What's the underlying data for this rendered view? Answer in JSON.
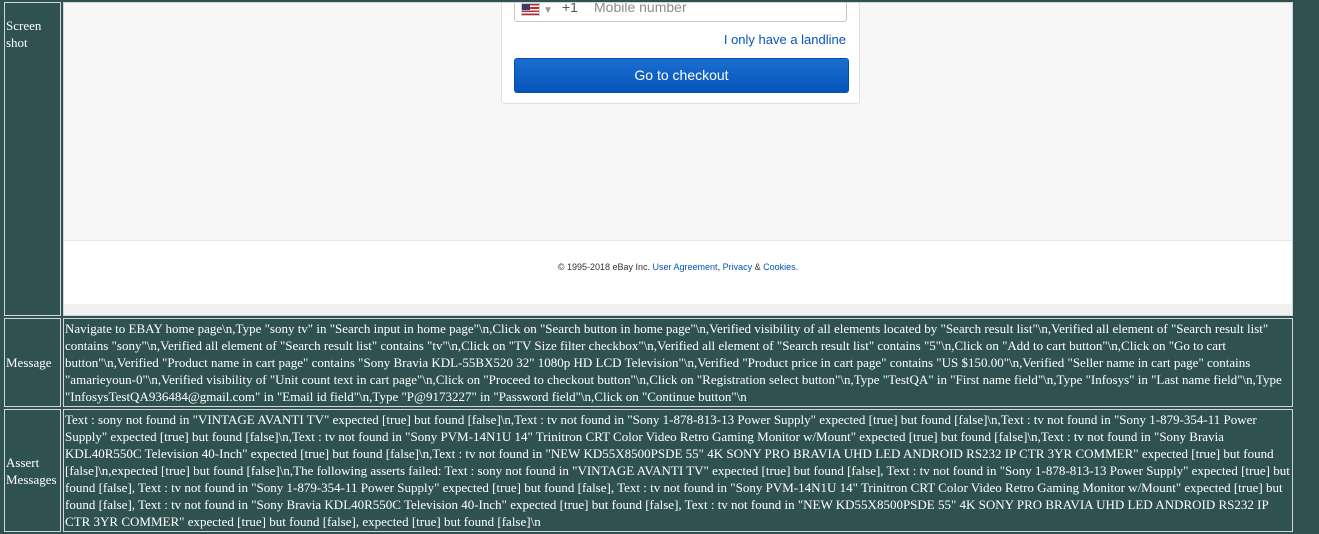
{
  "rows": {
    "screenshot": {
      "label": "Screen shot"
    },
    "message": {
      "label": "Message"
    },
    "assert": {
      "label": "Assert Messages"
    }
  },
  "screenshot_content": {
    "country_code": "+1",
    "mobile_placeholder": "Mobile number",
    "landline_link": "I only have a landline",
    "checkout_button": "Go to checkout",
    "footer": {
      "copyright": "© 1995-2018 eBay Inc.",
      "user_agreement": "User Agreement",
      "sep1": ",",
      "privacy": "Privacy",
      "amp": "&",
      "cookies": "Cookies",
      "period": "."
    }
  },
  "message_text": "Navigate to EBAY home page\\n,Type \"sony tv\" in \"Search input in home page\"\\n,Click on \"Search button in home page\"\\n,Verified visibility of all elements located by \"Search result list\"\\n,Verified all element of \"Search result list\" contains \"sony\"\\n,Verified all element of \"Search result list\" contains \"tv\"\\n,Click on \"TV Size filter checkbox\"\\n,Verified all element of \"Search result list\" contains \"5\"\\n,Click on \"Add to cart button\"\\n,Click on \"Go to cart button\"\\n,Verified \"Product name in cart page\" contains \"Sony Bravia KDL-55BX520 32\" 1080p HD LCD Television\"\\n,Verified \"Product price in cart page\" contains \"US $150.00\"\\n,Verified \"Seller name in cart page\" contains \"amarieyoun-0\"\\n,Verified visibility of \"Unit count text in cart page\"\\n,Click on \"Proceed to checkout button\"\\n,Click on \"Registration select button\"\\n,Type \"TestQA\" in \"First name field\"\\n,Type \"Infosys\" in \"Last name field\"\\n,Type \"InfosysTestQA936484@gmail.com\" in \"Email id field\"\\n,Type \"P@9173227\" in \"Password field\"\\n,Click on \"Continue button\"\\n",
  "assert_text": "Text : sony not found in \"VINTAGE AVANTI TV\" expected [true] but found [false]\\n,Text : tv not found in \"Sony 1-878-813-13 Power Supply\" expected [true] but found [false]\\n,Text : tv not found in \"Sony 1-879-354-11 Power Supply\" expected [true] but found [false]\\n,Text : tv not found in \"Sony PVM-14N1U 14\" Trinitron CRT Color Video Retro Gaming Monitor w/Mount\" expected [true] but found [false]\\n,Text : tv not found in \"Sony Bravia KDL40R550C Television 40-Inch\" expected [true] but found [false]\\n,Text : tv not found in \"NEW KD55X8500PSDE 55\" 4K SONY PRO BRAVIA UHD LED ANDROID RS232 IP CTR 3YR COMMER\" expected [true] but found [false]\\n,expected [true] but found [false]\\n,The following asserts failed: Text : sony not found in \"VINTAGE AVANTI TV\" expected [true] but found [false], Text : tv not found in \"Sony 1-878-813-13 Power Supply\" expected [true] but found [false], Text : tv not found in \"Sony 1-879-354-11 Power Supply\" expected [true] but found [false], Text : tv not found in \"Sony PVM-14N1U 14\" Trinitron CRT Color Video Retro Gaming Monitor w/Mount\" expected [true] but found [false], Text : tv not found in \"Sony Bravia KDL40R550C Television 40-Inch\" expected [true] but found [false], Text : tv not found in \"NEW KD55X8500PSDE 55\" 4K SONY PRO BRAVIA UHD LED ANDROID RS232 IP CTR 3YR COMMER\" expected [true] but found [false], expected [true] but found [false]\\n",
  "colors": {
    "page_background": "#2f5250",
    "link_blue": "#0654ba",
    "button_blue": "#0654ba"
  },
  "icons": {
    "flag": "us-flag-icon",
    "caret": "chevron-down-icon"
  }
}
